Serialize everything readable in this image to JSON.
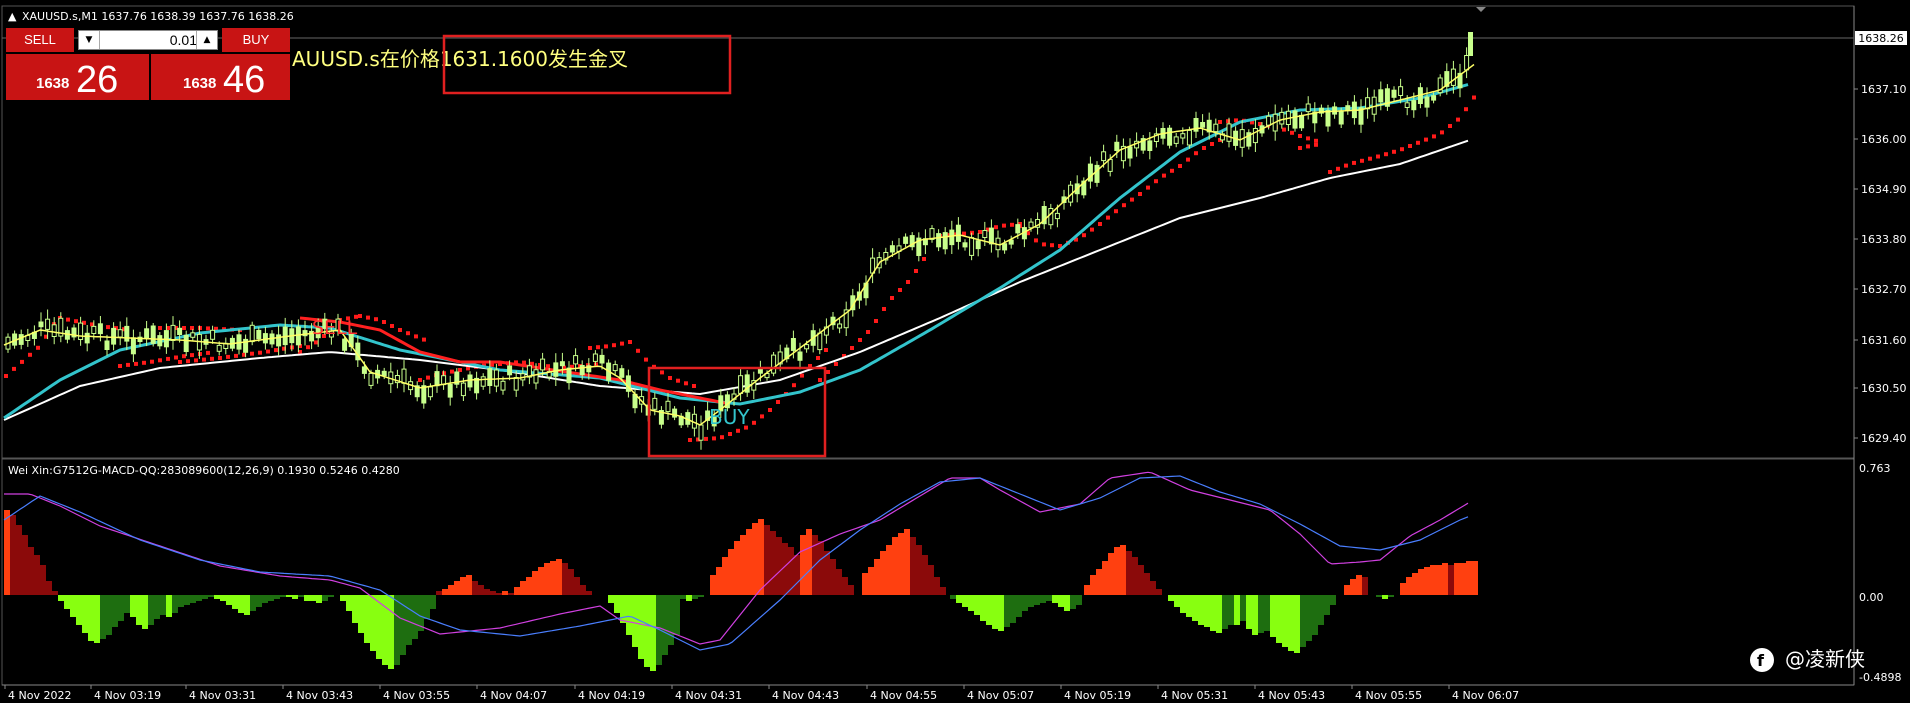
{
  "chart": {
    "header": "XAUUSD.s,M1  1637.76 1638.39 1637.76 1638.26",
    "alert_text": "AUUSD.s在价格1631.1600发生金叉",
    "sell_signal_label": "SELL",
    "buy_signal_label": "BUY",
    "current_price_label": "1638.26",
    "price_scale": [
      "1637.10",
      "1636.00",
      "1634.90",
      "1633.80",
      "1632.70",
      "1631.60",
      "1630.50",
      "1629.40"
    ],
    "indicator_header": "Wei Xin:G7512G-MACD-QQ:283089600(12,26,9) 0.1930 0.5246 0.4280",
    "indicator_scale": [
      "0.763",
      "0.00",
      "-0.4898"
    ],
    "time_axis": [
      "4 Nov 2022",
      "4 Nov 03:19",
      "4 Nov 03:31",
      "4 Nov 03:43",
      "4 Nov 03:55",
      "4 Nov 04:07",
      "4 Nov 04:19",
      "4 Nov 04:31",
      "4 Nov 04:43",
      "4 Nov 04:55",
      "4 Nov 05:07",
      "4 Nov 05:19",
      "4 Nov 05:31",
      "4 Nov 05:43",
      "4 Nov 05:55",
      "4 Nov 06:07"
    ],
    "watermark": "@凌新侠",
    "colors": {
      "bull_candle": "#c8ff8c",
      "ma_fast": "#ffff66",
      "ma_mid": "#33c4cc",
      "ma_slow": "#ffffff",
      "sar": "#ff1a1a",
      "macd_up": "#ff4010",
      "macd_up_dark": "#8b0a0a",
      "macd_down": "#88ff10",
      "macd_down_dark": "#1e6e10",
      "highlight": "#e02020"
    }
  },
  "trade_panel": {
    "sell_label": "SELL",
    "buy_label": "BUY",
    "lot_value": "0.01",
    "sell_price_prefix": "1638",
    "sell_price_suffix": "26",
    "buy_price_prefix": "1638",
    "buy_price_suffix": "46",
    "down_icon": "down-arrow-icon",
    "up_icon": "up-arrow-icon"
  }
}
